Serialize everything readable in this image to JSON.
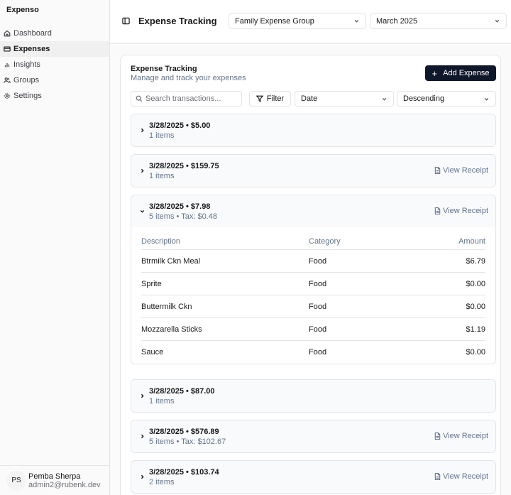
{
  "app": {
    "brand": "Expenso"
  },
  "sidebar": {
    "items": [
      {
        "label": "Dashboard",
        "icon": "home-icon",
        "active": false
      },
      {
        "label": "Expenses",
        "icon": "wallet-icon",
        "active": true
      },
      {
        "label": "Insights",
        "icon": "bar-chart-icon",
        "active": false
      },
      {
        "label": "Groups",
        "icon": "users-icon",
        "active": false
      },
      {
        "label": "Settings",
        "icon": "gear-icon",
        "active": false
      }
    ]
  },
  "user": {
    "initials": "PS",
    "name": "Pemba Sherpa",
    "email": "admin2@rubenk.dev"
  },
  "header": {
    "title": "Expense Tracking",
    "group_select": "Family Expense Group",
    "month_select": "March 2025"
  },
  "card": {
    "title": "Expense Tracking",
    "subtitle": "Manage and track your expenses",
    "add_button": "Add Expense"
  },
  "toolbar": {
    "search_placeholder": "Search transactions...",
    "filter_label": "Filter",
    "sort_field": "Date",
    "sort_order": "Descending"
  },
  "receipt_label": "View Receipt",
  "table_headers": {
    "description": "Description",
    "category": "Category",
    "amount": "Amount"
  },
  "groups": [
    {
      "title": "3/28/2025 • $5.00",
      "meta": "1 items",
      "has_receipt": false,
      "expanded": false
    },
    {
      "title": "3/28/2025 • $159.75",
      "meta": "1 items",
      "has_receipt": true,
      "expanded": false
    },
    {
      "title": "3/28/2025 • $7.98",
      "meta": "5 items • Tax: $0.48",
      "has_receipt": true,
      "expanded": true,
      "items": [
        {
          "description": "Btrmilk Ckn Meal",
          "category": "Food",
          "amount": "$6.79"
        },
        {
          "description": "Sprite",
          "category": "Food",
          "amount": "$0.00"
        },
        {
          "description": "Buttermilk Ckn",
          "category": "Food",
          "amount": "$0.00"
        },
        {
          "description": "Mozzarella Sticks",
          "category": "Food",
          "amount": "$1.19"
        },
        {
          "description": "Sauce",
          "category": "Food",
          "amount": "$0.00"
        }
      ]
    },
    {
      "title": "3/28/2025 • $87.00",
      "meta": "1 items",
      "has_receipt": false,
      "expanded": false
    },
    {
      "title": "3/28/2025 • $576.89",
      "meta": "5 items • Tax: $102.67",
      "has_receipt": true,
      "expanded": false
    },
    {
      "title": "3/28/2025 • $103.74",
      "meta": "2 items",
      "has_receipt": true,
      "expanded": false
    }
  ]
}
